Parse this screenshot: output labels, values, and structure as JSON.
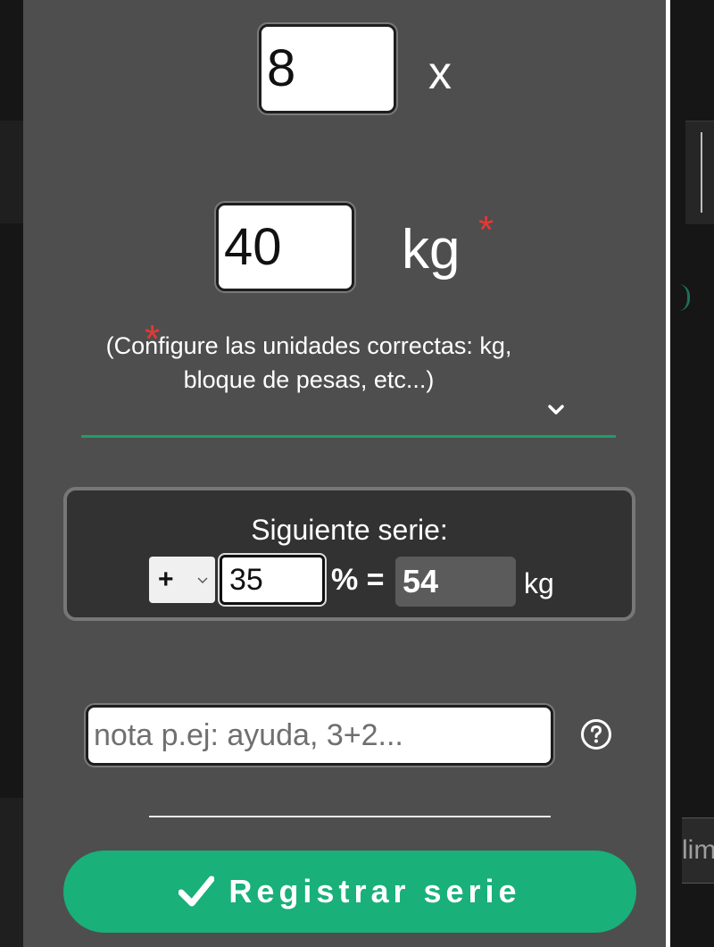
{
  "background": {
    "right_partial_text": "lim"
  },
  "form": {
    "reps_value": "8",
    "multiply_symbol": "x",
    "weight_value": "40",
    "weight_unit": "kg",
    "required_star": "*",
    "units_note": "(Configure las unidades correctas: kg, bloque de pesas, etc...)"
  },
  "next_set": {
    "title": "Siguiente serie:",
    "sign_selected": "+",
    "percent_value": "35",
    "percent_equals": "% =",
    "result_value": "54",
    "result_unit": "kg"
  },
  "note": {
    "placeholder": "nota p.ej: ayuda, 3+2..."
  },
  "actions": {
    "register_label": "Registrar serie"
  },
  "colors": {
    "modal_bg": "#4e4e4e",
    "accent_green": "#19b07a",
    "required_red": "#e53935"
  },
  "icons": [
    "chevron-down-icon",
    "help-icon",
    "check-icon"
  ]
}
